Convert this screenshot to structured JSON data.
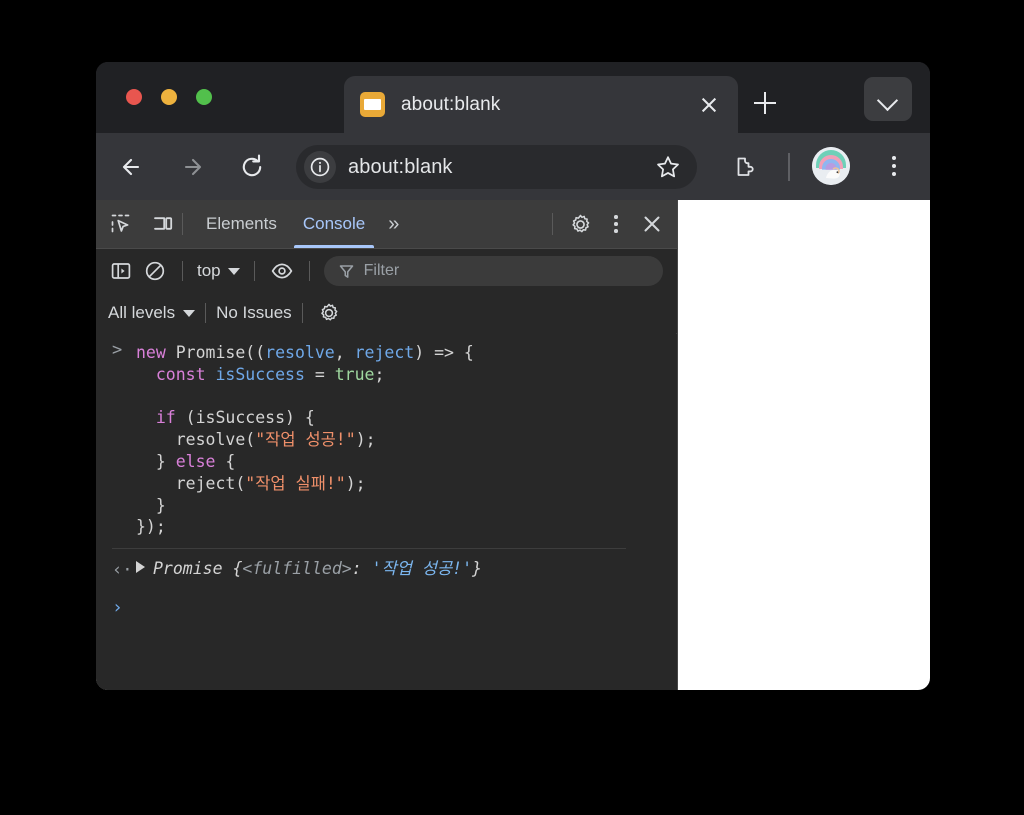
{
  "window": {
    "traffic_lights": [
      {
        "name": "close",
        "color": "#e8564f"
      },
      {
        "name": "minimize",
        "color": "#eeb23e"
      },
      {
        "name": "maximize",
        "color": "#52c04c"
      }
    ]
  },
  "tab_strip": {
    "tabs": [
      {
        "title": "about:blank",
        "favicon": "page-icon",
        "active": true
      }
    ],
    "new_tab_label": "+",
    "tab_list_icon": "chevron-down-icon"
  },
  "toolbar": {
    "back_icon": "back-arrow-icon",
    "forward_icon": "forward-arrow-icon",
    "reload_icon": "reload-icon",
    "site_info_icon": "info-circle-icon",
    "url": "about:blank",
    "bookmark_icon": "star-icon",
    "extensions_icon": "puzzle-piece-icon",
    "profile_icon": "avatar-unicorn-icon",
    "menu_icon": "three-dots-vertical-icon"
  },
  "devtools": {
    "inspect_icon": "inspect-element-icon",
    "device_toggle_icon": "device-toolbar-icon",
    "tabs": [
      {
        "label": "Elements",
        "active": false
      },
      {
        "label": "Console",
        "active": true
      }
    ],
    "more_tabs_label": "»",
    "settings_icon": "gear-icon",
    "more_options_icon": "three-dots-vertical-icon",
    "close_icon": "close-icon",
    "console_toolbar": {
      "sidebar_icon": "console-sidebar-icon",
      "clear_icon": "clear-console-icon",
      "context": "top",
      "context_caret": "caret-down-icon",
      "live_expression_icon": "eye-icon",
      "filter_icon": "filter-funnel-icon",
      "filter_placeholder": "Filter",
      "filter_value": ""
    },
    "levels_bar": {
      "level": "All levels",
      "level_caret": "caret-down-icon",
      "issues": "No Issues",
      "settings_icon": "gear-icon"
    },
    "console_log": {
      "input_prompt_mark": ">",
      "input_code_lines": [
        [
          {
            "t": "new",
            "c": "kw"
          },
          {
            "t": " ",
            "c": "plain"
          },
          {
            "t": "Promise",
            "c": "plain"
          },
          {
            "t": "((",
            "c": "punct"
          },
          {
            "t": "resolve",
            "c": "var"
          },
          {
            "t": ", ",
            "c": "punct"
          },
          {
            "t": "reject",
            "c": "var"
          },
          {
            "t": ") => {",
            "c": "punct"
          }
        ],
        [
          {
            "t": "  ",
            "c": "plain"
          },
          {
            "t": "const",
            "c": "kw"
          },
          {
            "t": " ",
            "c": "plain"
          },
          {
            "t": "isSuccess",
            "c": "var"
          },
          {
            "t": " = ",
            "c": "punct"
          },
          {
            "t": "true",
            "c": "bool"
          },
          {
            "t": ";",
            "c": "punct"
          }
        ],
        [],
        [
          {
            "t": "  ",
            "c": "plain"
          },
          {
            "t": "if",
            "c": "kw"
          },
          {
            "t": " (isSuccess) {",
            "c": "punct"
          }
        ],
        [
          {
            "t": "    resolve(",
            "c": "plain"
          },
          {
            "t": "\"작업 성공!\"",
            "c": "str"
          },
          {
            "t": ");",
            "c": "punct"
          }
        ],
        [
          {
            "t": "  } ",
            "c": "punct"
          },
          {
            "t": "else",
            "c": "kw"
          },
          {
            "t": " {",
            "c": "punct"
          }
        ],
        [
          {
            "t": "    reject(",
            "c": "plain"
          },
          {
            "t": "\"작업 실패!\"",
            "c": "str"
          },
          {
            "t": ");",
            "c": "punct"
          }
        ],
        [
          {
            "t": "  }",
            "c": "punct"
          }
        ],
        [
          {
            "t": "});",
            "c": "punct"
          }
        ]
      ],
      "result_mark": "‹·",
      "result_disclosure": "triangle-right-icon",
      "result_class": "Promise",
      "result_open_brace": " {",
      "result_internal_key": "<fulfilled>",
      "result_colon": ": ",
      "result_value": "'작업 성공!'",
      "result_close_brace": "}",
      "next_prompt_mark": "›"
    }
  }
}
